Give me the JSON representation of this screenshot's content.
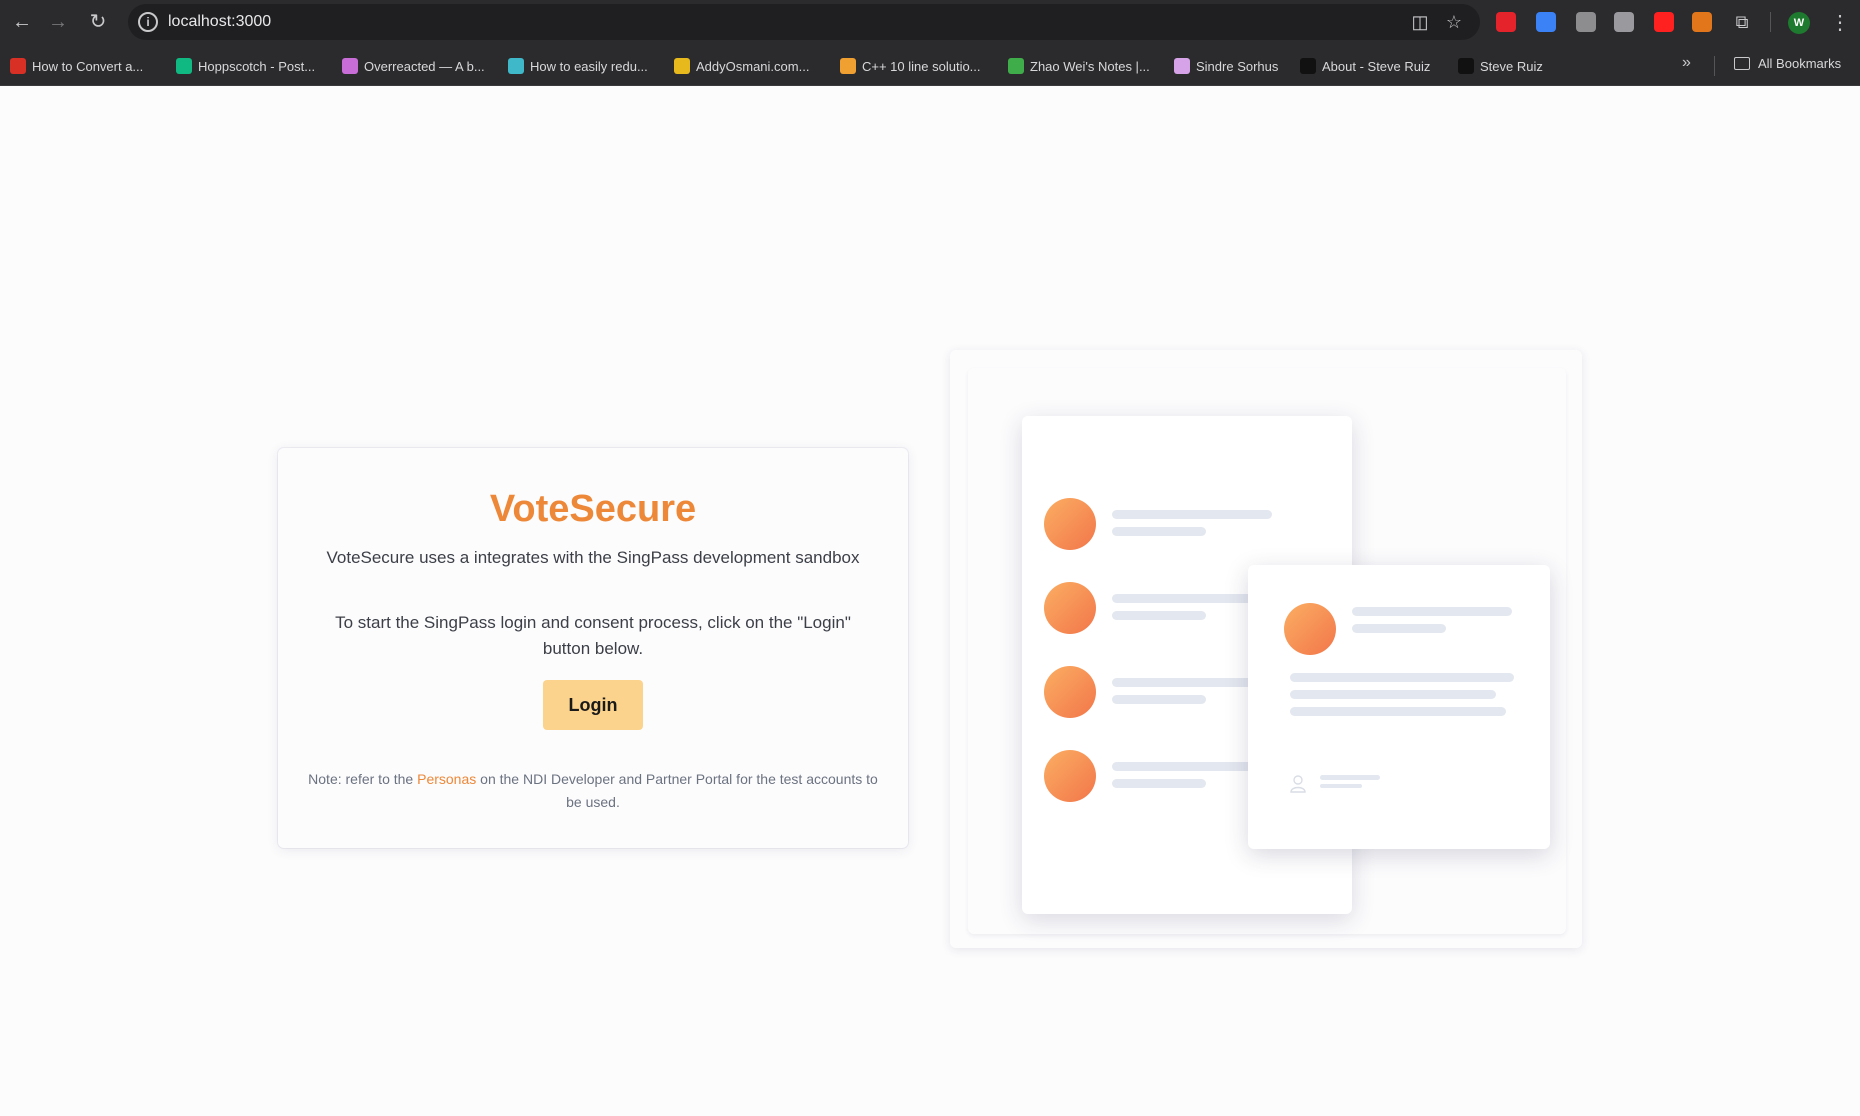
{
  "browser": {
    "url": "localhost:3000",
    "bookmarks": [
      {
        "label": "How to Convert a...",
        "color": "#d93025"
      },
      {
        "label": "Hoppscotch - Post...",
        "color": "#10b981"
      },
      {
        "label": "Overreacted — A b...",
        "color": "#c86dd7"
      },
      {
        "label": "How to easily redu...",
        "color": "#3fb8c9"
      },
      {
        "label": "AddyOsmani.com...",
        "color": "#e8b91c"
      },
      {
        "label": "C++ 10 line solutio...",
        "color": "#f0a030"
      },
      {
        "label": "Zhao Wei's Notes |...",
        "color": "#3fae4a"
      },
      {
        "label": "Sindre Sorhus",
        "color": "#d7a3e8"
      },
      {
        "label": "About - Steve Ruiz",
        "color": "#111111"
      },
      {
        "label": "Steve Ruiz",
        "color": "#111111"
      }
    ],
    "all_bookmarks_label": "All Bookmarks",
    "profile_initial": "W",
    "extensions": [
      {
        "name": "stop-extension-icon",
        "color": "#e5232b"
      },
      {
        "name": "compass-extension-icon",
        "color": "#3b82f6"
      },
      {
        "name": "globe-extension-icon",
        "color": "#8d8d90"
      },
      {
        "name": "zed-extension-icon",
        "color": "#9a9a9e"
      },
      {
        "name": "youtube-extension-icon",
        "color": "#ff2020"
      },
      {
        "name": "metamask-extension-icon",
        "color": "#e2761b"
      }
    ]
  },
  "card": {
    "title": "VoteSecure",
    "intro": "VoteSecure uses a integrates with the SingPass development sandbox",
    "instructions": "To start the SingPass login and consent process, click on the \"Login\" button below.",
    "login_label": "Login",
    "note_prefix": "Note: refer to the ",
    "note_link": "Personas",
    "note_suffix": " on the NDI Developer and Partner Portal for the test accounts to be used."
  },
  "colors": {
    "accent": "#ed8838",
    "button": "#fbd38d"
  }
}
